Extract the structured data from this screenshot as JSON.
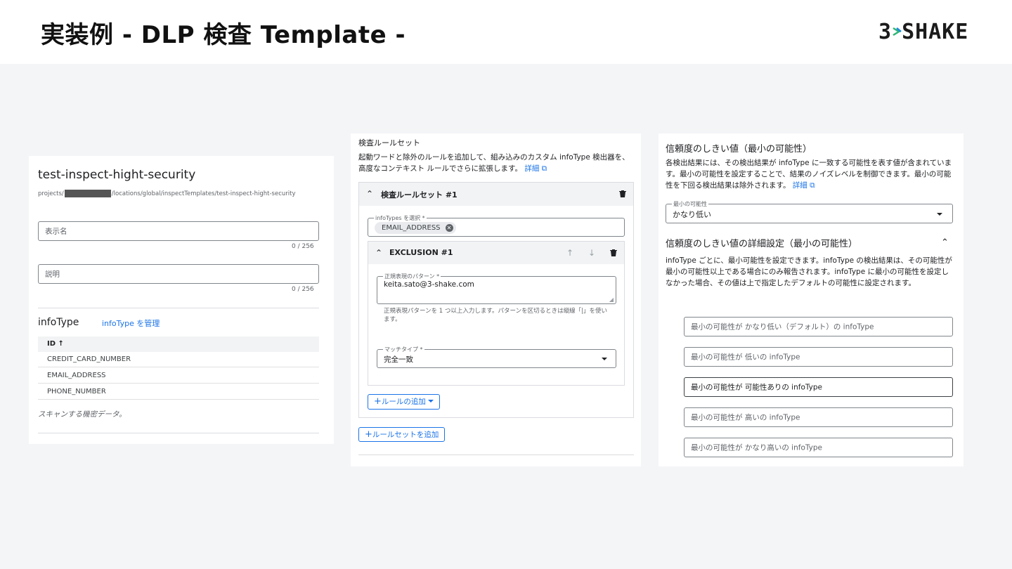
{
  "slide": {
    "title": "実装例 - DLP 検査 Template -",
    "logo": "3SHAKE",
    "logo_prefix": "3",
    "logo_suffix": "SHAKE"
  },
  "template_panel": {
    "name": "test-inspect-hight-security",
    "path_prefix": "projects/",
    "path_suffix": "/locations/global/inspectTemplates/test-inspect-hight-security",
    "display_name_placeholder": "表示名",
    "display_name_counter": "0 / 256",
    "description_placeholder": "説明",
    "description_counter": "0 / 256",
    "infotype_label": "infoType",
    "manage_link": "infoType を管理",
    "table_header": "ID",
    "rows": [
      "CREDIT_CARD_NUMBER",
      "EMAIL_ADDRESS",
      "PHONE_NUMBER"
    ],
    "footer_note": "スキャンする機密データ。"
  },
  "ruleset_panel": {
    "title": "検査ルールセット",
    "description": "起動ワードと除外のルールを追加して、組み込みのカスタム infoType 検出器を、高度なコンテキスト ルールでさらに拡張します。",
    "details_link": "詳細",
    "ruleset_header": "検査ルールセット #1",
    "infotypes_label": "infoTypes を選択 *",
    "chip": "EMAIL_ADDRESS",
    "exclusion_header": "EXCLUSION #1",
    "regex_label": "正規表現のパターン *",
    "regex_value": "keita.sato@3-shake.com",
    "regex_help": "正規表現パターンを 1 つ以上入力します。パターンを区切るときは縦線「|」を使います。",
    "match_type_label": "マッチタイプ *",
    "match_type_value": "完全一致",
    "add_rule_button": "ルールの追加",
    "add_ruleset_button": "ルールセットを追加"
  },
  "likelihood_panel": {
    "title": "信頼度のしきい値（最小の可能性）",
    "description": "各検出結果には、その検出結果が infoType に一致する可能性を表す値が含まれています。最小の可能性を設定することで、結果のノイズレベルを制御できます。最小の可能性を下回る検出結果は除外されます。",
    "details_link": "詳細",
    "min_likelihood_label": "最小の可能性",
    "min_likelihood_value": "かなり低い",
    "advanced_title": "信頼度のしきい値の詳細設定（最小の可能性）",
    "advanced_description": "infoType ごとに、最小可能性を設定できます。infoType の検出結果は、その可能性が最小の可能性以上である場合にのみ報告されます。infoType に最小の可能性を設定しなかった場合、その値は上で指定したデフォルトの可能性に設定されます。",
    "levels": [
      "最小の可能性が かなり低い（デフォルト）の infoType",
      "最小の可能性が 低いの infoType",
      "最小の可能性が 可能性ありの infoType",
      "最小の可能性が 高いの infoType",
      "最小の可能性が かなり高いの infoType"
    ]
  },
  "colors": {
    "accent": "#1a73e8",
    "logo_arrow_green": "#2bb673",
    "logo_arrow_blue": "#1e88e5"
  }
}
